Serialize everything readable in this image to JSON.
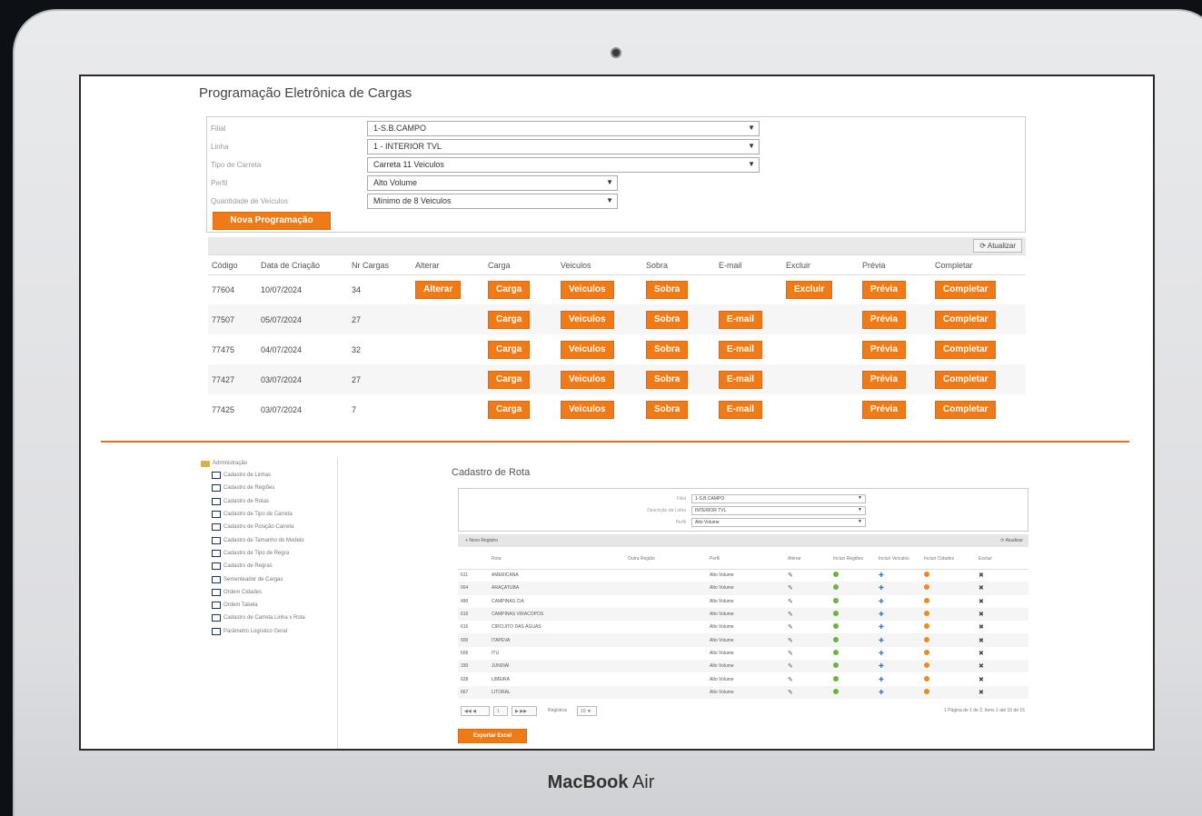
{
  "device": {
    "brand_bold": "MacBook",
    "brand_light": "Air"
  },
  "colors": {
    "accent": "#f07b16",
    "divider": "#e07018",
    "tree_icon": "#1a2c6a"
  },
  "programacao": {
    "title": "Programação Eletrônica de Cargas",
    "filters": [
      {
        "label": "Filial",
        "value": "1-S.B.CAMPO"
      },
      {
        "label": "Linha",
        "value": "1 - INTERIOR TVL"
      },
      {
        "label": "Tipo de Carreta",
        "value": "Carreta 11 Veiculos"
      },
      {
        "label": "Perfil",
        "value": "Alto Volume"
      },
      {
        "label": "Quantidade de Veículos",
        "value": "Mínimo de 8 Veiculos"
      }
    ],
    "new_button": "Nova Programação",
    "refresh_button": "Atualizar",
    "columns": [
      "Código",
      "Data de Criação",
      "Nr Cargas",
      "Alterar",
      "Carga",
      "Veiculos",
      "Sobra",
      "E-mail",
      "Excluir",
      "Prévia",
      "Completar"
    ],
    "button_labels": {
      "alterar": "Alterar",
      "carga": "Carga",
      "veiculos": "Veiculos",
      "sobra": "Sobra",
      "email": "E-mail",
      "excluir": "Excluir",
      "previa": "Prévia",
      "completar": "Completar"
    },
    "rows": [
      {
        "codigo": "77604",
        "data": "10/07/2024",
        "nr_cargas": "34",
        "has_alterar": true,
        "has_email": false,
        "has_excluir": true
      },
      {
        "codigo": "77507",
        "data": "05/07/2024",
        "nr_cargas": "27",
        "has_alterar": false,
        "has_email": true,
        "has_excluir": false
      },
      {
        "codigo": "77475",
        "data": "04/07/2024",
        "nr_cargas": "32",
        "has_alterar": false,
        "has_email": true,
        "has_excluir": false
      },
      {
        "codigo": "77427",
        "data": "03/07/2024",
        "nr_cargas": "27",
        "has_alterar": false,
        "has_email": true,
        "has_excluir": false
      },
      {
        "codigo": "77425",
        "data": "03/07/2024",
        "nr_cargas": "7",
        "has_alterar": false,
        "has_email": true,
        "has_excluir": false
      }
    ]
  },
  "tree": {
    "root": "Administração",
    "items": [
      "Cadastro de Linhas",
      "Cadastro de Regiões",
      "Cadastro de Rotas",
      "Cadastro de Tipo de Carreta",
      "Cadastro de Posição Carreta",
      "Cadastro de Tamanho do Modelo",
      "Cadastro de Tipo de Regra",
      "Cadastro de Regras",
      "Sementeador de Cargas",
      "Ordem Cidades",
      "Ordem Tabela",
      "Cadastro de Carreta Linha x Rota",
      "Parâmetro Logístico Geral"
    ]
  },
  "cadastro_rotas": {
    "title": "Cadastro de Rota",
    "filters": [
      {
        "label": "Filial",
        "value": "1-S.B.CAMPO"
      },
      {
        "label": "Descrição da Linha",
        "value": "INTERIOR TVL"
      },
      {
        "label": "Perfil",
        "value": "Alto Volume"
      }
    ],
    "bar_left": "Novo Registro",
    "bar_right": "Atualizar",
    "columns": [
      "",
      "Rota",
      "Outra Região",
      "Perfil",
      "Alterar",
      "Incluir Regiões",
      "Incluir Veículos",
      "Incluir Cidades",
      "Excluir"
    ],
    "rows": [
      {
        "id": "611",
        "rota": "AMERICANA",
        "perfil": "Alto Volume"
      },
      {
        "id": "664",
        "rota": "ARAÇATUBA",
        "perfil": "Alto Volume"
      },
      {
        "id": "490",
        "rota": "CAMPINAS CIA",
        "perfil": "Alto Volume"
      },
      {
        "id": "616",
        "rota": "CAMPINAS VIRACOPOS",
        "perfil": "Alto Volume"
      },
      {
        "id": "615",
        "rota": "CIRCUITO DAS ÁGUAS",
        "perfil": "Alto Volume"
      },
      {
        "id": "600",
        "rota": "ITAPEVA",
        "perfil": "Alto Volume"
      },
      {
        "id": "606",
        "rota": "ITU",
        "perfil": "Alto Volume"
      },
      {
        "id": "330",
        "rota": "JUNDIAÍ",
        "perfil": "Alto Volume"
      },
      {
        "id": "628",
        "rota": "LIMEIRA",
        "perfil": "Alto Volume"
      },
      {
        "id": "667",
        "rota": "LITORAL",
        "perfil": "Alto Volume"
      }
    ],
    "pager": {
      "page": "1",
      "page_size": "10",
      "page_size_label": "Registros",
      "summary": "1 Página de 1 de 2, Itens 1 até 10 de 15"
    },
    "excel_button": "Exportar Excel"
  }
}
